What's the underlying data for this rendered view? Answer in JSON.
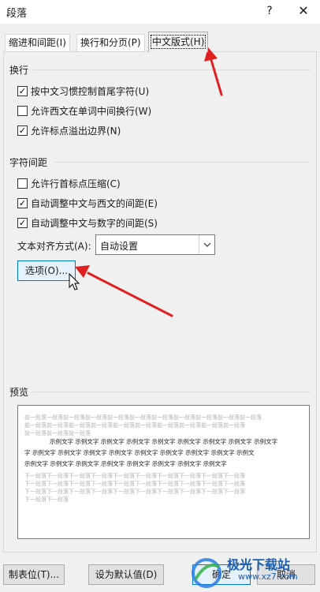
{
  "window": {
    "title": "段落",
    "help": "?",
    "close": "✕"
  },
  "tabs": [
    "缩进和间距(I)",
    "换行和分页(P)",
    "中文版式(H)"
  ],
  "line_break": {
    "title": "换行",
    "options": [
      {
        "label": "按中文习惯控制首尾字符(U)",
        "checked": true
      },
      {
        "label": "允许西文在单词中间换行(W)",
        "checked": false
      },
      {
        "label": "允许标点溢出边界(N)",
        "checked": true
      }
    ]
  },
  "spacing": {
    "title": "字符间距",
    "options": [
      {
        "label": "允许行首标点压缩(C)",
        "checked": false
      },
      {
        "label": "自动调整中文与西文的间距(E)",
        "checked": true
      },
      {
        "label": "自动调整中文与数字的间距(S)",
        "checked": true
      }
    ],
    "align_label": "文本对齐方式(A):",
    "align_value": "自动设置",
    "options_button": "选项(O)..."
  },
  "preview": {
    "title": "预览",
    "before_lines": [
      "前一段落一段落前一段落前一段落前一段落前一段落前一段落前一段落前一段落前一段落前一段落",
      "前一段落前一段落前一段落前一段落前一段落前一段落前一段落前一段落前一段落前一段落",
      "前一段落前一段落前一段落"
    ],
    "sample_lines": [
      "示例文字  示例文字  示例文字  示例文字  示例文字  示例文字  示例文字  示例文字  示例文字",
      "字  示例文字  示例文字  示例文字  示例文字  示例文字  示例文字  示例文字  示例文字  示例文",
      "示例文字  示例文字  示例文字  示例文字  示例文字  示例文字  示例文字  示例文字"
    ],
    "after_lines": [
      "下一段落下一段落下一段落下一段落下一段落下一段落下一段落下一段落下一段落下一段落",
      "下一段落下一段落下一段落下一段落下一段落下一段落下一段落下一段落下一段落下一段落",
      "下一段落下一段落下一段落下一段落下一段落下一段落下一段落下一段落下一段落下一段落",
      "下一段落下一段落"
    ]
  },
  "footer": {
    "tabs_button": "制表位(T)...",
    "default_button": "设为默认值(D)",
    "ok_button": "确定",
    "cancel_button": "取消"
  },
  "watermark": {
    "name": "极光下载站",
    "url": "www.xz7.com"
  },
  "colors": {
    "arrow": "#e02020",
    "accent": "#0078d7"
  }
}
